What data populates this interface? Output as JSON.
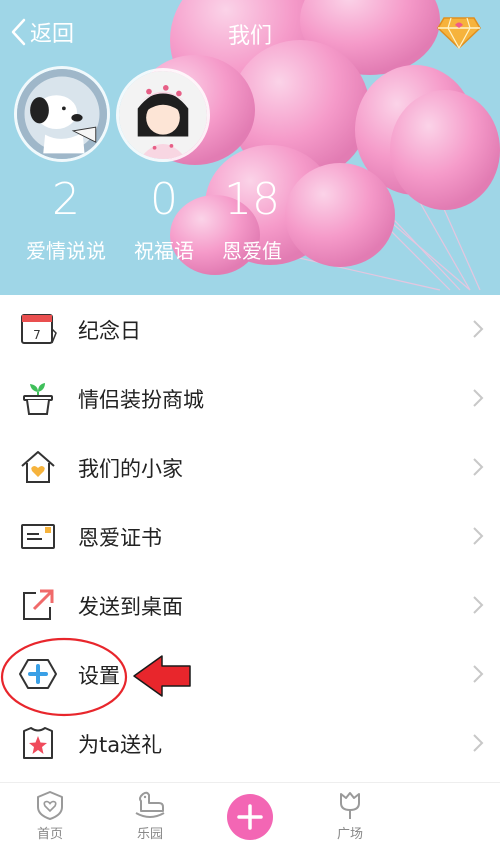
{
  "nav": {
    "back_label": "返回",
    "title": "我们",
    "vip_icon": "diamond-icon"
  },
  "stats": [
    {
      "value": "2",
      "label": "爱情说说"
    },
    {
      "value": "0",
      "label": "祝福语"
    },
    {
      "value": "18",
      "label": "恩爱值"
    }
  ],
  "menu": [
    {
      "label": "纪念日",
      "icon": "calendar-icon",
      "icon_text": "7"
    },
    {
      "label": "情侣装扮商城",
      "icon": "plant-pot-icon"
    },
    {
      "label": "我们的小家",
      "icon": "house-heart-icon"
    },
    {
      "label": "恩爱证书",
      "icon": "certificate-icon"
    },
    {
      "label": "发送到桌面",
      "icon": "share-arrow-icon"
    },
    {
      "label": "设置",
      "icon": "settings-hexagon-icon"
    },
    {
      "label": "为ta送礼",
      "icon": "gift-star-icon"
    }
  ],
  "tabs": [
    {
      "label": "首页",
      "icon": "heart-shield-icon"
    },
    {
      "label": "乐园",
      "icon": "rocking-horse-icon"
    },
    {
      "label": "",
      "icon": "plus-icon"
    },
    {
      "label": "广场",
      "icon": "tulip-icon"
    }
  ],
  "colors": {
    "accent": "#f366b4",
    "header_bg": "#9fd6e7",
    "balloon": "#f59ac9",
    "annotation": "#e8262c"
  }
}
